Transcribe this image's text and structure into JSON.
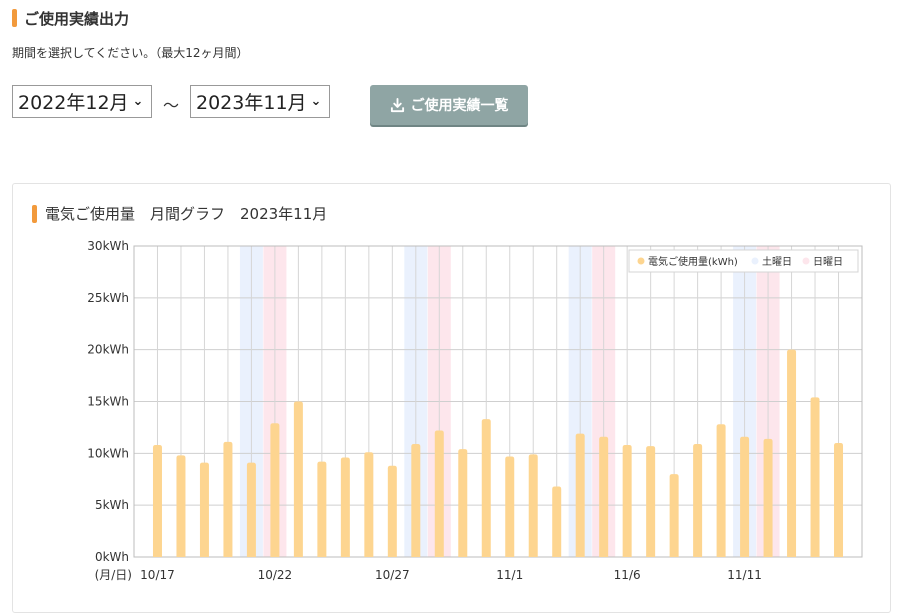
{
  "page": {
    "heading": "ご使用実績出力",
    "description": "期間を選択してください。（最大12ヶ月間）",
    "from_select": "2022年12月",
    "separator": "～",
    "to_select": "2023年11月",
    "download_button": "ご使用実績一覧"
  },
  "colors": {
    "accent": "#f29a3c",
    "bar": "#fdd590",
    "saturday": "#eaf1fd",
    "sunday": "#fde6ec",
    "button": "#8fa5a4"
  },
  "chart_data": {
    "type": "bar",
    "title": "電気ご使用量　月間グラフ　2023年11月",
    "xlabel": "(月/日)",
    "ylabel": "",
    "ylim": [
      0,
      30
    ],
    "yticks": [
      "0kWh",
      "5kWh",
      "10kWh",
      "15kWh",
      "20kWh",
      "25kWh",
      "30kWh"
    ],
    "x_tick_labels": [
      {
        "index": 0,
        "label": "10/17"
      },
      {
        "index": 5,
        "label": "10/22"
      },
      {
        "index": 10,
        "label": "10/27"
      },
      {
        "index": 15,
        "label": "11/1"
      },
      {
        "index": 20,
        "label": "11/6"
      },
      {
        "index": 25,
        "label": "11/11"
      }
    ],
    "categories": [
      "10/17",
      "10/18",
      "10/19",
      "10/20",
      "10/21",
      "10/22",
      "10/23",
      "10/24",
      "10/25",
      "10/26",
      "10/27",
      "10/28",
      "10/29",
      "10/30",
      "10/31",
      "11/1",
      "11/2",
      "11/3",
      "11/4",
      "11/5",
      "11/6",
      "11/7",
      "11/8",
      "11/9",
      "11/10",
      "11/11",
      "11/12",
      "11/13",
      "11/14",
      "11/15"
    ],
    "saturday_indices": [
      4,
      11,
      18,
      25
    ],
    "sunday_indices": [
      5,
      12,
      19,
      26
    ],
    "series": [
      {
        "name": "電気ご使用量(kWh)",
        "values": [
          10.8,
          9.8,
          9.1,
          11.1,
          9.1,
          12.9,
          15.0,
          9.2,
          9.6,
          10.1,
          8.8,
          10.9,
          12.2,
          10.4,
          13.3,
          9.7,
          9.9,
          6.8,
          11.9,
          11.6,
          10.8,
          10.7,
          8.0,
          10.9,
          12.8,
          11.6,
          11.4,
          20.0,
          15.4,
          11.0
        ]
      }
    ],
    "legend": {
      "position": "top-right",
      "items": [
        "電気ご使用量(kWh)",
        "土曜日",
        "日曜日"
      ]
    },
    "grid": true
  }
}
